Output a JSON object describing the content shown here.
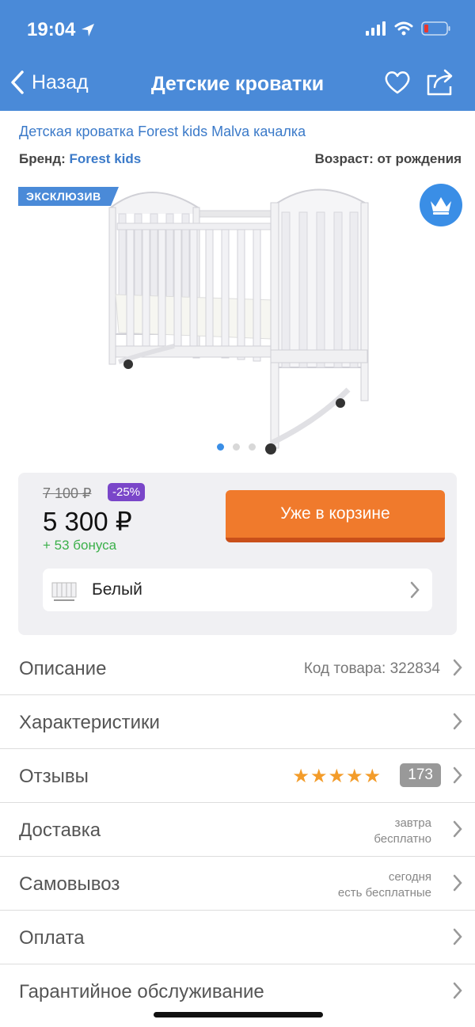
{
  "status_bar": {
    "time": "19:04"
  },
  "navbar": {
    "back_label": "Назад",
    "title": "Детские кроватки"
  },
  "product": {
    "name": "Детская кроватка Forest kids Malva качалка",
    "brand_label": "Бренд:",
    "brand_value": "Forest kids",
    "age_label": "Возраст:",
    "age_value": "от рождения",
    "badge": "ЭКСКЛЮЗИВ",
    "gallery": {
      "count": 3,
      "active_index": 0
    }
  },
  "price_block": {
    "old_price": "7 100 ₽",
    "discount": "-25%",
    "price": "5 300 ₽",
    "bonus": "+ 53 бонуса",
    "cart_button": "Уже в корзине",
    "color": "Белый"
  },
  "rows": [
    {
      "label": "Описание",
      "meta": "Код товара: 322834"
    },
    {
      "label": "Характеристики"
    },
    {
      "label": "Отзывы",
      "stars": "★★★★★",
      "count": "173"
    },
    {
      "label": "Доставка",
      "meta_line1": "завтра",
      "meta_line2": "бесплатно"
    },
    {
      "label": "Самовывоз",
      "meta_line1": "сегодня",
      "meta_line2": "есть бесплатные"
    },
    {
      "label": "Оплата"
    },
    {
      "label": "Гарантийное обслуживание"
    }
  ],
  "colors": {
    "header": "#4a8ad8",
    "accent_blue": "#3b7ac9",
    "cart_orange": "#f07a2c",
    "discount_purple": "#7a46c9",
    "bonus_green": "#3bb04a",
    "stars": "#f39c2a"
  },
  "icons": [
    "location-arrow-icon",
    "signal-icon",
    "wifi-icon",
    "battery-icon",
    "back-chevron-icon",
    "heart-icon",
    "share-icon",
    "crown-icon",
    "chevron-right-icon"
  ]
}
